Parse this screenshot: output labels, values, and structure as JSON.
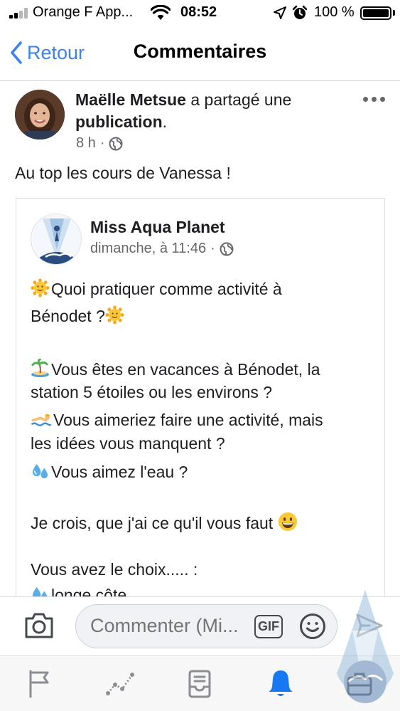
{
  "status_bar": {
    "carrier": "Orange F App...",
    "time": "08:52",
    "battery": "100 %"
  },
  "nav": {
    "back_label": "Retour",
    "title": "Commentaires"
  },
  "post": {
    "author": "Maëlle Metsue",
    "action": " a partagé une ",
    "object": "publication",
    "period": ".",
    "time": "8 h",
    "separator": "·",
    "text": "Au top les cours de Vanessa !"
  },
  "shared": {
    "page_name": "Miss Aqua Planet",
    "time": "dimanche, à 11:46",
    "separator": "·",
    "lines": [
      "Quoi pratiquer comme activité à",
      "Bénodet ?",
      "Vous êtes en vacances à Bénodet, la",
      "station 5 étoiles ou les environs ?",
      "Vous aimeriez faire une activité, mais",
      "les idées vous manquent ?",
      "Vous aimez l'eau ?",
      "Je crois, que j'ai ce qu'il vous faut",
      "Vous avez le choix..... :",
      "longe côte"
    ]
  },
  "composer": {
    "placeholder": "Commenter (Mi...",
    "gif_label": "GIF"
  },
  "icons": {
    "camera": "camera-icon",
    "emoji": "smiley-icon",
    "send": "send-icon",
    "tabs": [
      "flag-icon",
      "insights-icon",
      "inbox-icon",
      "notifications-bell-icon",
      "briefcase-icon"
    ]
  },
  "colors": {
    "accent": "#3b82f0",
    "secondary_text": "#65676b",
    "active_tab": "#1877f2"
  }
}
